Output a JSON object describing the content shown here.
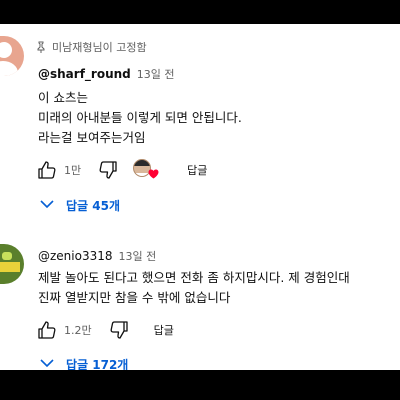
{
  "comments": [
    {
      "pinned_label": "미남재형님이 고정함",
      "author": "@sharf_round",
      "time": "13일 전",
      "lines": [
        "이 쇼츠는",
        "미래의 아내분들 이렇게 되면 안됩니다.",
        "라는걸 보여주는거임"
      ],
      "likes": "1만",
      "reply_label": "답글",
      "replies_label": "답글 45개",
      "avatar_color": "#e8a58f"
    },
    {
      "author": "@zenio3318",
      "time": "13일 전",
      "lines": [
        "제발 놀아도 된다고 했으면 전화 좀 하지맙시다. 제 경험인대",
        "진짜 열받지만 참을 수 밖에 없습니다"
      ],
      "likes": "1.2만",
      "reply_label": "답글",
      "replies_label": "답글 172개"
    }
  ],
  "colors": {
    "link": "#065fd4",
    "secondary_text": "#606060",
    "heart": "#ff0033"
  },
  "icons": [
    "pin-icon",
    "like-icon",
    "dislike-icon",
    "creator-heart-icon",
    "chevron-down-icon"
  ]
}
